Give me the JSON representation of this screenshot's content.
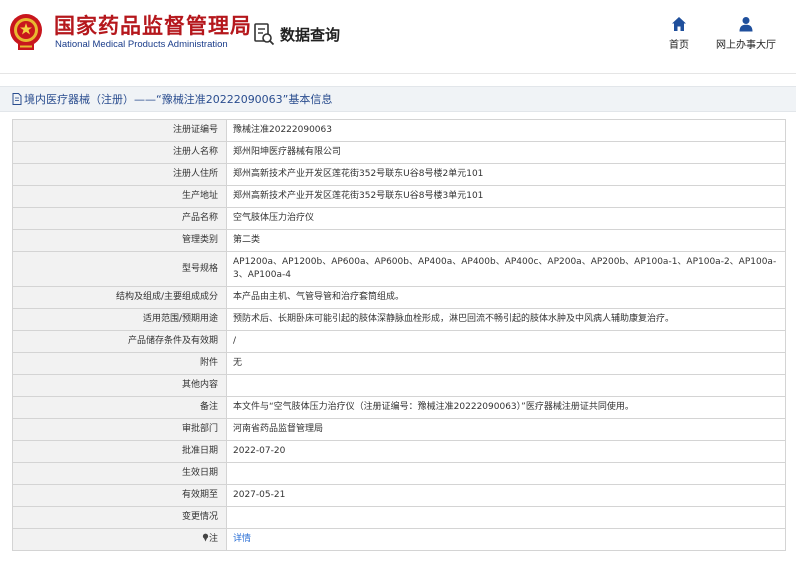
{
  "header": {
    "title_cn": "国家药品监督管理局",
    "title_en": "National Medical Products Administration",
    "search_label": "数据查询",
    "nav": [
      {
        "label": "首页",
        "icon": "home-icon"
      },
      {
        "label": "网上办事大厅",
        "icon": "user-icon"
      }
    ],
    "brand_color": "#b5171c"
  },
  "breadcrumb": {
    "text": "境内医疗器械（注册）——“豫械注准20222090063”基本信息"
  },
  "rows": [
    {
      "label": "注册证编号",
      "value": "豫械注准20222090063"
    },
    {
      "label": "注册人名称",
      "value": "郑州阳坤医疗器械有限公司"
    },
    {
      "label": "注册人住所",
      "value": "郑州高新技术产业开发区莲花街352号联东U谷8号楼2单元101"
    },
    {
      "label": "生产地址",
      "value": "郑州高新技术产业开发区莲花街352号联东U谷8号楼3单元101"
    },
    {
      "label": "产品名称",
      "value": "空气肢体压力治疗仪"
    },
    {
      "label": "管理类别",
      "value": "第二类"
    },
    {
      "label": "型号规格",
      "value": "AP1200a、AP1200b、AP600a、AP600b、AP400a、AP400b、AP400c、AP200a、AP200b、AP100a-1、AP100a-2、AP100a-3、AP100a-4"
    },
    {
      "label": "结构及组成/主要组成成分",
      "value": "本产品由主机、气管导管和治疗套筒组成。"
    },
    {
      "label": "适用范围/预期用途",
      "value": "预防术后、长期卧床可能引起的肢体深静脉血栓形成，淋巴回流不畅引起的肢体水肿及中风病人辅助康复治疗。"
    },
    {
      "label": "产品储存条件及有效期",
      "value": "/"
    },
    {
      "label": "附件",
      "value": "无"
    },
    {
      "label": "其他内容",
      "value": ""
    },
    {
      "label": "备注",
      "value": "本文件与“空气肢体压力治疗仪（注册证编号：豫械注准20222090063）”医疗器械注册证共同使用。"
    },
    {
      "label": "审批部门",
      "value": "河南省药品监督管理局"
    },
    {
      "label": "批准日期",
      "value": "2022-07-20"
    },
    {
      "label": "生效日期",
      "value": ""
    },
    {
      "label": "有效期至",
      "value": "2027-05-21"
    },
    {
      "label": "变更情况",
      "value": ""
    }
  ],
  "note_row": {
    "label": "注",
    "link": "详情",
    "icon": "pin-icon"
  }
}
